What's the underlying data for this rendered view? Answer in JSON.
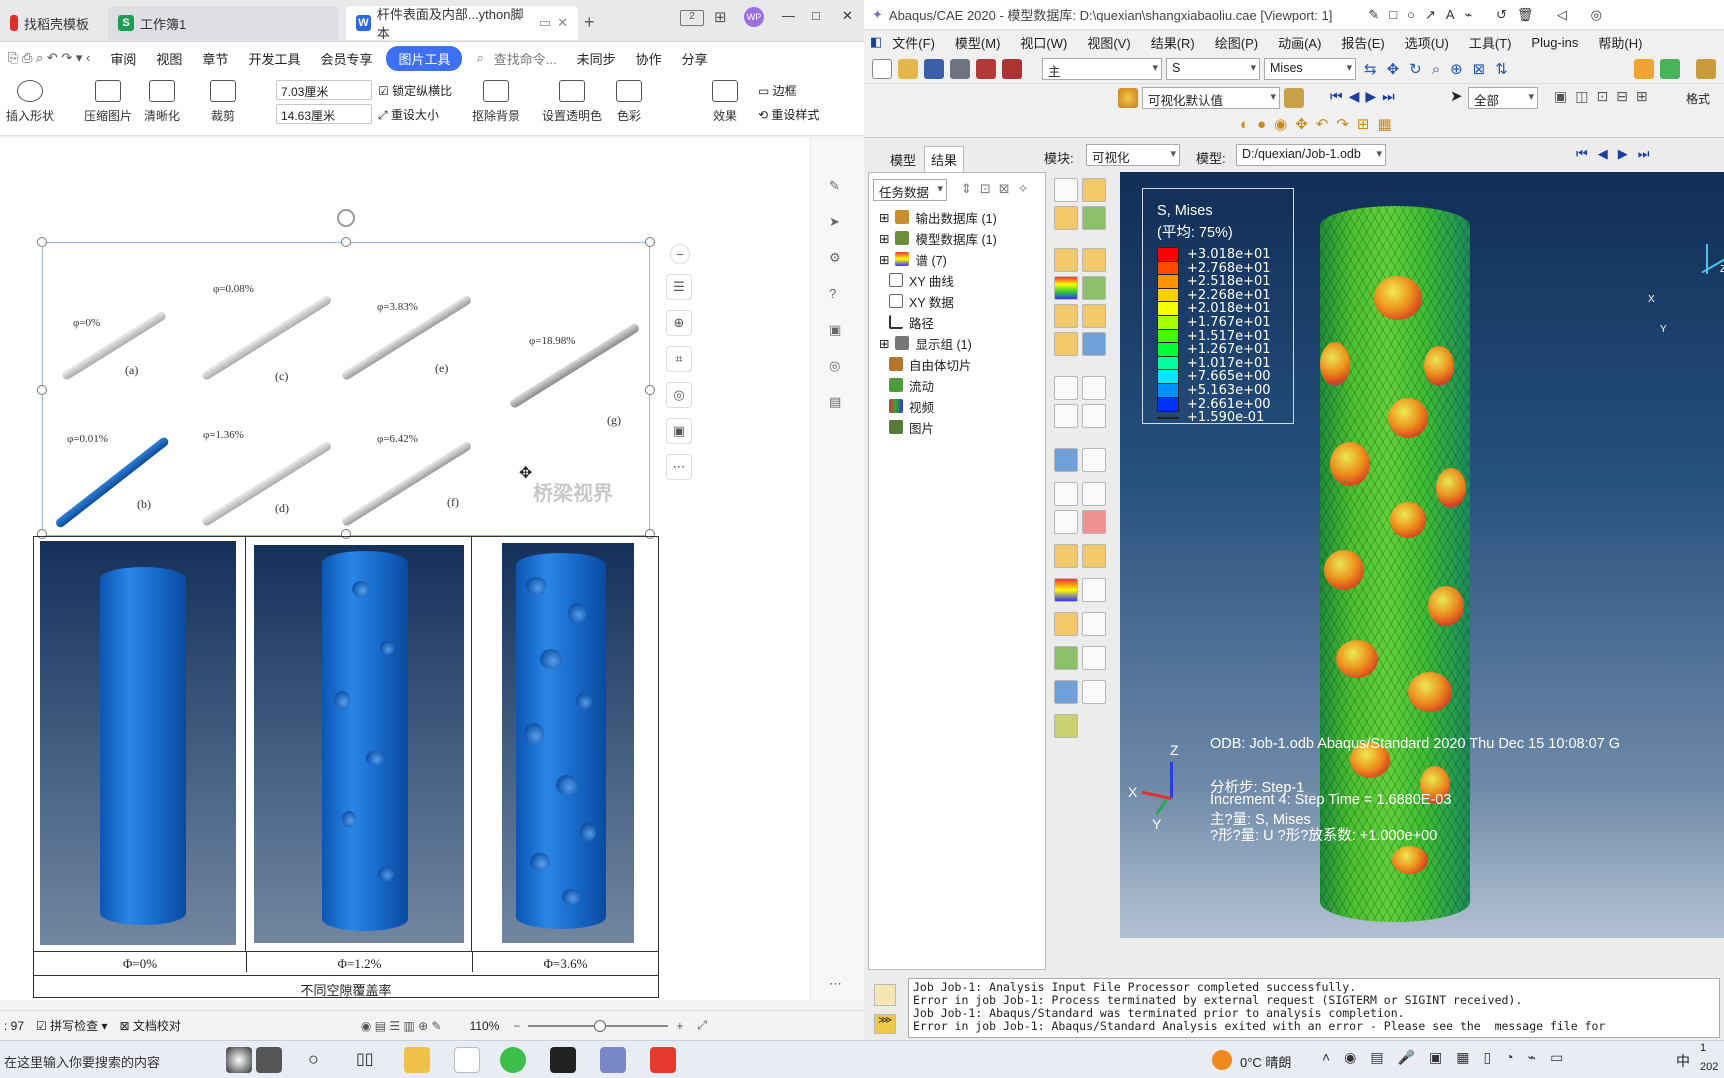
{
  "wps": {
    "tabs": [
      {
        "label": "找稻壳模板",
        "icon_color": "#e0302b"
      },
      {
        "label": "工作簿1",
        "icon_color": "#1f9d55",
        "icon_glyph": "S"
      },
      {
        "label": "杆件表面及内部...ython脚本",
        "icon_color": "#2b67e0",
        "icon_glyph": "W"
      }
    ],
    "window_controls": {
      "min": "—",
      "max": "□",
      "close": "✕"
    },
    "menu": [
      "审阅",
      "视图",
      "章节",
      "开发工具",
      "会员专享"
    ],
    "menu_active": "图片工具",
    "search_placeholder": "查找命令...",
    "menu_right": [
      "未同步",
      "协作",
      "分享"
    ],
    "ribbon": {
      "insert_shape": "插入形状",
      "compress": "压缩图片",
      "sharpen": "清晰化",
      "crop": "裁剪",
      "width": "7.03厘米",
      "height": "14.63厘米",
      "lock_ratio": "锁定纵横比",
      "reset_size": "重设大小",
      "remove_bg": "抠除背景",
      "transparent": "设置透明色",
      "color": "色彩",
      "effect": "效果",
      "border": "边框",
      "reset_style": "重设样式"
    },
    "figure": {
      "labels": [
        "φ=0%",
        "φ=0.08%",
        "φ=3.83%",
        "φ=18.98%",
        "φ=0.01%",
        "φ=1.36%",
        "φ=6.42%"
      ],
      "sublabels": [
        "(a)",
        "(c)",
        "(e)",
        "(g)",
        "(b)",
        "(d)",
        "(f)"
      ],
      "watermark": "桥梁视界",
      "captions": [
        "Φ=0%",
        "Φ=1.2%",
        "Φ=3.6%"
      ],
      "table_title": "不同空隙覆盖率"
    },
    "status": {
      "page_num": ": 97",
      "spellcheck": "拼写检查",
      "doc_proof": "文档校对",
      "zoom": "110%"
    }
  },
  "abaqus": {
    "title": "Abaqus/CAE 2020 - 模型数据库: D:\\quexian\\shangxiabaoliu.cae [Viewport: 1]",
    "menu": [
      "文件(F)",
      "模型(M)",
      "视口(W)",
      "视图(V)",
      "结果(R)",
      "绘图(P)",
      "动画(A)",
      "报告(E)",
      "选项(U)",
      "工具(T)",
      "Plug-ins",
      "帮助(H)"
    ],
    "toolbar": {
      "combo_main": "主",
      "combo_var": "S",
      "combo_comp": "Mises",
      "combo_style": "可视化默认值",
      "combo_all": "全部",
      "format_label": "格式"
    },
    "context": {
      "module_label": "模块:",
      "module_value": "可视化",
      "model_label": "模型:",
      "model_value": "D:/quexian/Job-1.odb"
    },
    "tree_tabs": [
      "模型",
      "结果"
    ],
    "tree_combo": "任务数据",
    "tree": [
      "输出数据库 (1)",
      "模型数据库 (1)",
      "谱 (7)",
      "XY 曲线",
      "XY 数据",
      "路径",
      "显示组 (1)",
      "自由体切片",
      "流动",
      "视频",
      "图片"
    ],
    "legend": {
      "title": "S, Mises",
      "subtitle": "(平均: 75%)",
      "values": [
        "+3.018e+01",
        "+2.768e+01",
        "+2.518e+01",
        "+2.268e+01",
        "+2.018e+01",
        "+1.767e+01",
        "+1.517e+01",
        "+1.267e+01",
        "+1.017e+01",
        "+7.665e+00",
        "+5.163e+00",
        "+2.661e+00",
        "+1.590e-01"
      ],
      "colors": [
        "#ff0000",
        "#ff4a00",
        "#ff9400",
        "#ffcf00",
        "#f4ff00",
        "#a8ff00",
        "#3dff00",
        "#00ff32",
        "#00ff9c",
        "#00e7ff",
        "#0090ff",
        "#0032ff",
        "#0000ff"
      ]
    },
    "viewport_info": {
      "odb": "ODB: Job-1.odb    Abaqus/Standard 2020    Thu Dec 15 10:08:07 G",
      "step": "分析步: Step-1",
      "increment": "Increment     4: Step Time =    1.6880E-03",
      "primary": "主?量: S, Mises",
      "deform": "?形?量: U   ?形?放系数: +1.000e+00"
    },
    "axes": {
      "x": "X",
      "y": "Y",
      "z": "Z"
    },
    "messages": [
      "Job Job-1: Analysis Input File Processor completed successfully.",
      "Error in job Job-1: Process terminated by external request (SIGTERM or SIGINT received).",
      "Job Job-1: Abaqus/Standard was terminated prior to analysis completion.",
      "Error in job Job-1: Abaqus/Standard Analysis exited with an error - Please see the  message file for"
    ]
  },
  "taskbar": {
    "search_placeholder": "在这里输入你要搜索的内容",
    "weather": "0°C  晴朗",
    "ime": "中",
    "date_fragment": "202",
    "time_fragment": "1"
  }
}
